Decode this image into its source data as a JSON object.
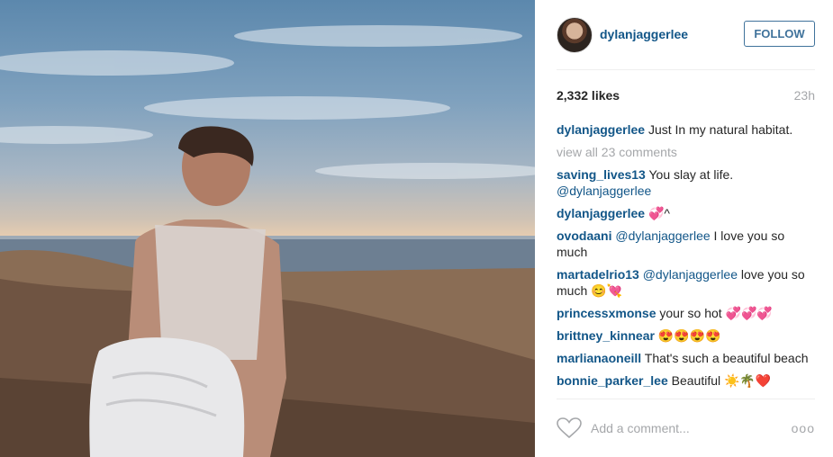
{
  "post": {
    "username": "dylanjaggerlee",
    "follow_label": "FOLLOW",
    "likes": "2,332 likes",
    "time_ago": "23h",
    "caption": "Just In my natural habitat.",
    "view_all": "view all 23 comments"
  },
  "comments": [
    {
      "user": "saving_lives13",
      "text": "You slay at life.",
      "mention": "@dylanjaggerlee",
      "mention_after": true
    },
    {
      "user": "dylanjaggerlee",
      "text": "💞^"
    },
    {
      "user": "ovodaani",
      "mention": "@dylanjaggerlee",
      "text": "I love you so much"
    },
    {
      "user": "martadelrio13",
      "mention": "@dylanjaggerlee",
      "text": "love you so much 😊💘"
    },
    {
      "user": "princessxmonse",
      "text": "your so hot 💞💞💞"
    },
    {
      "user": "brittney_kinnear",
      "text": "😍😍😍😍"
    },
    {
      "user": "marlianaoneill",
      "text": "That's such a beautiful beach"
    },
    {
      "user": "bonnie_parker_lee",
      "text": "Beautiful ☀️🌴❤️"
    }
  ],
  "footer": {
    "add_comment_placeholder": "Add a comment...",
    "more_label": "ooo"
  },
  "colors": {
    "username": "#125688",
    "follow_border": "#3f729b",
    "muted": "#a5a7aa"
  },
  "icons": {
    "like": "heart-outline-icon",
    "more": "more-options-icon"
  }
}
